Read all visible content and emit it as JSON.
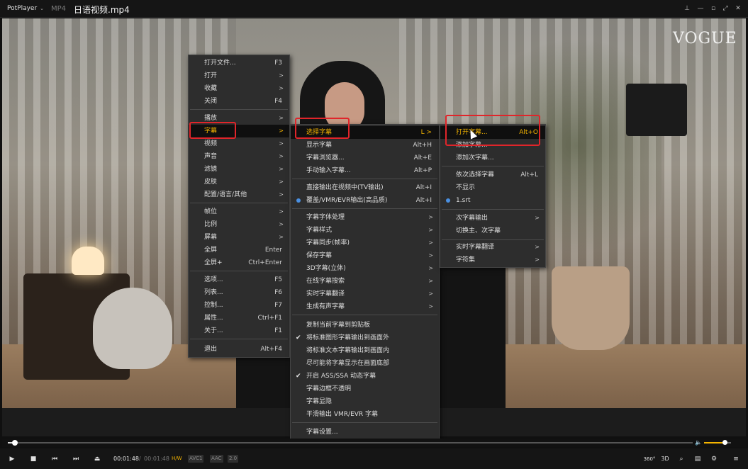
{
  "titlebar": {
    "app_name": "PotPlayer",
    "format": "MP4",
    "file_title": "日语视频.mp4"
  },
  "video": {
    "watermark": "VOGUE"
  },
  "main_menu": {
    "items": [
      {
        "label": "打开文件...",
        "shortcut": "F3"
      },
      {
        "label": "打开",
        "submenu": true
      },
      {
        "label": "收藏",
        "submenu": true
      },
      {
        "label": "关闭",
        "shortcut": "F4"
      },
      {
        "label": "播放",
        "submenu": true
      },
      {
        "label": "字幕",
        "submenu": true,
        "highlighted": true
      },
      {
        "label": "视频",
        "submenu": true
      },
      {
        "label": "声音",
        "submenu": true
      },
      {
        "label": "滤镜",
        "submenu": true
      },
      {
        "label": "皮肤",
        "submenu": true
      },
      {
        "label": "配置/语言/其他",
        "submenu": true
      },
      {
        "label": "帧位",
        "submenu": true
      },
      {
        "label": "比例",
        "submenu": true
      },
      {
        "label": "屏幕",
        "submenu": true
      },
      {
        "label": "全屏",
        "shortcut": "Enter"
      },
      {
        "label": "全屏+",
        "shortcut": "Ctrl+Enter"
      },
      {
        "label": "选项...",
        "shortcut": "F5"
      },
      {
        "label": "列表...",
        "shortcut": "F6"
      },
      {
        "label": "控制...",
        "shortcut": "F7"
      },
      {
        "label": "属性...",
        "shortcut": "Ctrl+F1"
      },
      {
        "label": "关于...",
        "shortcut": "F1"
      },
      {
        "label": "退出",
        "shortcut": "Alt+F4"
      }
    ]
  },
  "subtitle_menu": {
    "items": [
      {
        "label": "选择字幕",
        "shortcut": "L",
        "submenu": true,
        "highlighted": true
      },
      {
        "label": "显示字幕",
        "shortcut": "Alt+H"
      },
      {
        "label": "字幕浏览器...",
        "shortcut": "Alt+E"
      },
      {
        "label": "手动输入字幕...",
        "shortcut": "Alt+P"
      },
      {
        "label": "直接输出在视频中(TV输出)",
        "shortcut": "Alt+I"
      },
      {
        "label": "覆盖/VMR/EVR输出(高品质)",
        "shortcut": "Alt+I",
        "radio": true
      },
      {
        "label": "字幕字体处理",
        "submenu": true
      },
      {
        "label": "字幕样式",
        "submenu": true
      },
      {
        "label": "字幕同步(帧率)",
        "submenu": true
      },
      {
        "label": "保存字幕",
        "submenu": true
      },
      {
        "label": "3D字幕(立体)",
        "submenu": true
      },
      {
        "label": "在线字幕搜索",
        "submenu": true
      },
      {
        "label": "实时字幕翻译",
        "submenu": true
      },
      {
        "label": "生成有声字幕",
        "submenu": true
      },
      {
        "label": "复制当前字幕到剪贴板"
      },
      {
        "label": "将标准图形字幕输出到画面外",
        "checked": true
      },
      {
        "label": "将标准文本字幕输出到画面内"
      },
      {
        "label": "尽可能将字幕显示在画面底部"
      },
      {
        "label": "开启 ASS/SSA 动态字幕",
        "checked": true
      },
      {
        "label": "字幕边框不透明"
      },
      {
        "label": "字幕显隐"
      },
      {
        "label": "平滑输出 VMR/EVR 字幕"
      },
      {
        "label": "字幕设置..."
      }
    ]
  },
  "select_menu": {
    "items": [
      {
        "label": "打开字幕...",
        "shortcut": "Alt+O",
        "highlighted": true
      },
      {
        "label": "添加字幕..."
      },
      {
        "label": "添加次字幕..."
      },
      {
        "label": "依次选择字幕",
        "shortcut": "Alt+L"
      },
      {
        "label": "不显示"
      },
      {
        "label": "1.srt",
        "radio": true
      },
      {
        "label": "次字幕输出",
        "submenu": true
      },
      {
        "label": "切换主、次字幕"
      },
      {
        "label": "实时字幕翻译",
        "submenu": true
      },
      {
        "label": "字符集",
        "submenu": true
      }
    ]
  },
  "controls": {
    "current_time": "00:01:48",
    "separator": "/",
    "total_time": "00:01:48",
    "badges": [
      "H/W",
      "AVC1",
      "AAC",
      "2.0"
    ],
    "right_buttons": [
      "360°",
      "3D"
    ]
  },
  "seek": {
    "progress": 0.01
  },
  "volume": {
    "level": 0.75
  },
  "colors": {
    "accent": "#f4b400",
    "highlight_box": "#e0252a",
    "menu_bg": "#2d2d2d"
  }
}
